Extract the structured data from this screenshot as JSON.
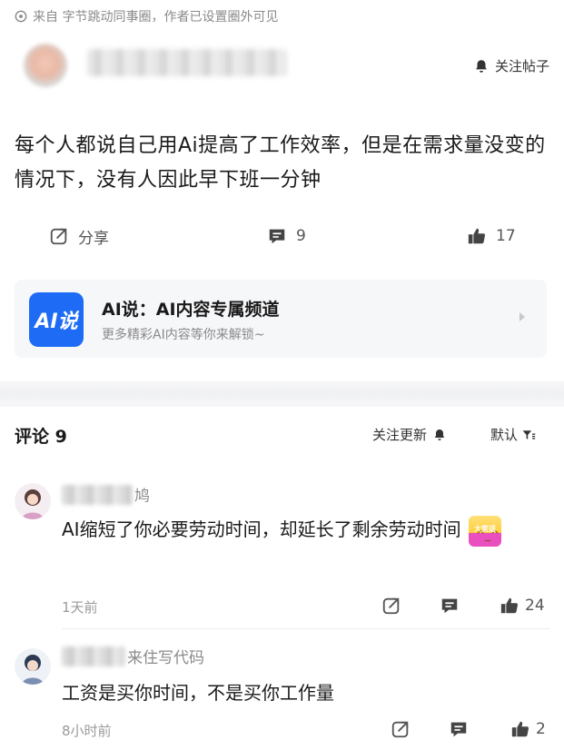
{
  "source": {
    "text": "来自 字节跳动同事圈，作者已设置圈外可见",
    "icon": "info-circle-icon"
  },
  "post": {
    "follow_label": "关注帖子",
    "content": "每个人都说自己用Ai提高了工作效率，但是在需求量没变的情况下，没有人因此早下班一分钟",
    "share_label": "分享",
    "comment_count": "9",
    "like_count": "17"
  },
  "channel": {
    "logo_text": "AI说",
    "title": "AI说：AI内容专属频道",
    "subtitle": "更多精彩AI内容等你来解锁~"
  },
  "comments_header": {
    "title": "评论 9",
    "follow_update": "关注更新",
    "sort": "默认"
  },
  "comments": [
    {
      "name_visible": "鸠",
      "text": "AI缩短了你必要劳动时间，却延长了剩余劳动时间",
      "sticker_label": "大笑话",
      "time": "1天前",
      "likes": "24"
    },
    {
      "name_visible": "来住写代码",
      "text": "工资是买你时间，不是买你工作量",
      "time": "8小时前",
      "likes": "2"
    }
  ],
  "colors": {
    "accent_blue": "#1e6cf5",
    "muted": "#8a8a8a",
    "text": "#1a1a1a",
    "card_bg": "#f6f7f9"
  }
}
